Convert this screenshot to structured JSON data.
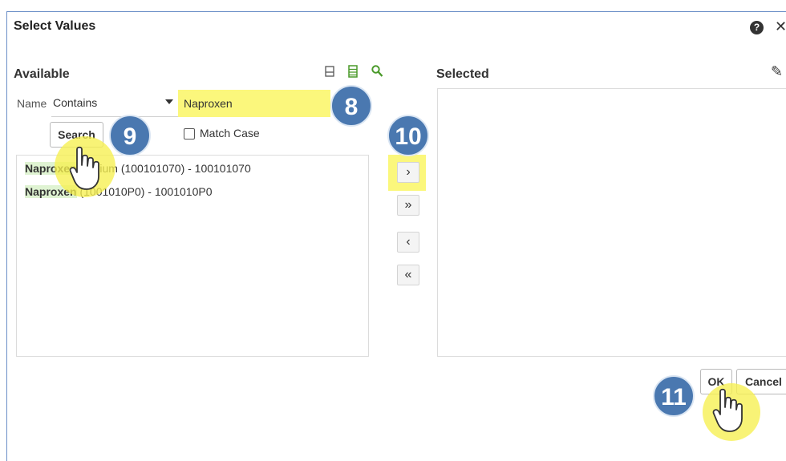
{
  "dialog": {
    "title": "Select Values",
    "help_icon_glyph": "?",
    "close_icon_glyph": "✕"
  },
  "available": {
    "label": "Available",
    "name_label": "Name",
    "operator_value": "Contains",
    "search_value": "Naproxen",
    "search_button": "Search",
    "match_case_label": "Match Case",
    "match_case_checked": false,
    "items": [
      {
        "highlight": "Naproxen",
        "rest": " Sodium (100101070) - 100101070"
      },
      {
        "highlight": "Naproxen",
        "rest": " (1001010P0) - 1001010P0"
      }
    ]
  },
  "selected": {
    "label": "Selected",
    "edit_icon_glyph": "✎"
  },
  "shuttle": {
    "move": "›",
    "move_all": "»",
    "remove": "‹",
    "remove_all": "«"
  },
  "footer": {
    "ok": "OK",
    "cancel": "Cancel"
  },
  "steps": {
    "step8": "8",
    "step9": "9",
    "step10": "10",
    "step11": "11"
  },
  "colors": {
    "highlight_yellow": "#fbf77c",
    "badge_blue": "#4a78b0",
    "match_green": "#dff3d2",
    "frame_border": "#6b8fc7"
  },
  "icons": [
    "help-icon",
    "close-icon",
    "single-view-icon",
    "list-view-icon",
    "search-icon",
    "pencil-icon",
    "pointer-hand-icon"
  ]
}
